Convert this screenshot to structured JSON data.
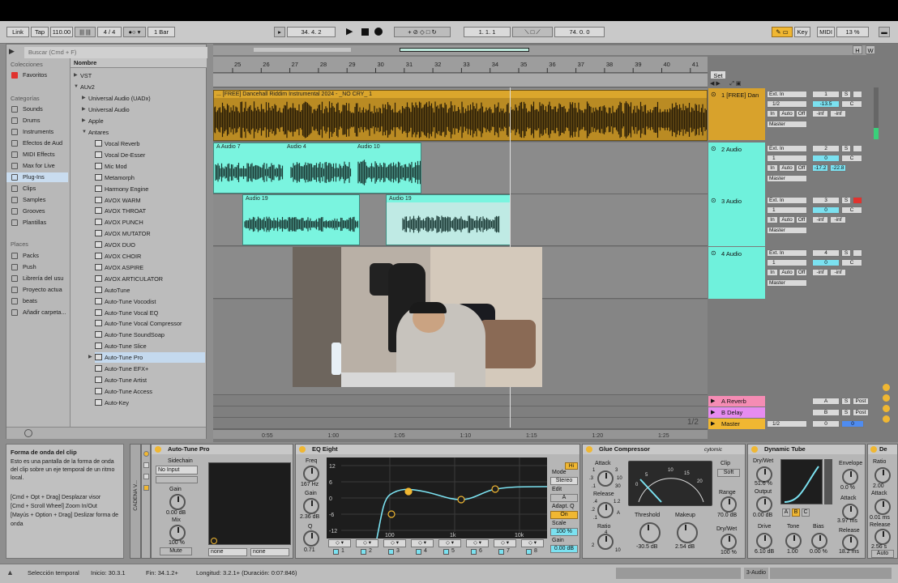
{
  "control_bar": {
    "link": "Link",
    "tap": "Tap",
    "tempo": "110.00",
    "signature": "4 / 4",
    "metro": "1 Bar",
    "position": "34.  4.  2",
    "loop_start": "1.  1.  1",
    "loop_length": "74.  0.  0",
    "key": "Key",
    "midi": "MIDI",
    "cpu": "13 %"
  },
  "browser": {
    "search_placeholder": "Buscar (Cmd + F)",
    "collections_title": "Colecciones",
    "favorites": "Favoritos",
    "categories_title": "Categorías",
    "categories": [
      "Sounds",
      "Drums",
      "Instruments",
      "Efectos de Aud",
      "MIDI Effects",
      "Max for Live",
      "Plug-Ins",
      "Clips",
      "Samples",
      "Grooves",
      "Plantillas"
    ],
    "places_title": "Places",
    "places": [
      "Packs",
      "Push",
      "Librería del usu",
      "Proyecto actua",
      "beats",
      "Añadir carpeta..."
    ],
    "name_header": "Nombre",
    "tree": [
      {
        "label": "VST",
        "indent": 0,
        "tri": "▶"
      },
      {
        "label": "AUv2",
        "indent": 0,
        "tri": "▼"
      },
      {
        "label": "Universal Audio (UADx)",
        "indent": 1,
        "tri": "▶"
      },
      {
        "label": "Universal Audio",
        "indent": 1,
        "tri": "▶"
      },
      {
        "label": "Apple",
        "indent": 1,
        "tri": "▶"
      },
      {
        "label": "Antares",
        "indent": 1,
        "tri": "▼"
      }
    ],
    "plugins": [
      "Vocal Reverb",
      "Vocal De-Esser",
      "Mic Mod",
      "Metamorph",
      "Harmony Engine",
      "AVOX WARM",
      "AVOX THROAT",
      "AVOX PUNCH",
      "AVOX MUTATOR",
      "AVOX DUO",
      "AVOX CHOIR",
      "AVOX ASPIRE",
      "AVOX ARTICULATOR",
      "AutoTune",
      "Auto-Tune Vocodist",
      "Auto-Tune Vocal EQ",
      "Auto-Tune Vocal Compressor",
      "Auto-Tune SoundSoap",
      "Auto-Tune Slice",
      "Auto-Tune Pro",
      "Auto-Tune EFX+",
      "Auto-Tune Artist",
      "Auto-Tune Access",
      "Auto-Key"
    ]
  },
  "ruler": {
    "bars": [
      "25",
      "26",
      "27",
      "28",
      "29",
      "30",
      "31",
      "32",
      "33",
      "34",
      "35",
      "36",
      "37",
      "38",
      "39",
      "40",
      "41"
    ],
    "time": [
      "0:55",
      "1:00",
      "1:05",
      "1:10",
      "1:15",
      "1:20",
      "1:25"
    ],
    "zoom": "1/2",
    "set": "Set"
  },
  "clips": {
    "beat": "... [FREE] Dancehall Riddim Instrumental 2024 - _NO CRY_ 1",
    "a7": "A Audio 7",
    "a4": "Audio 4",
    "a10": "Audio 10",
    "a19a": "Audio 19",
    "a19b": "Audio 19"
  },
  "tracks": [
    {
      "name": "1 [FREE] Dan",
      "num": "1",
      "color": "#d8a22c",
      "input": "Ext. In",
      "ch": "1/2",
      "vol": "-13.5",
      "pan": "C",
      "out": "Master",
      "peak1": "-inf",
      "peak2": "-inf"
    },
    {
      "name": "2 Audio",
      "num": "2",
      "color": "#6ff1dc",
      "input": "Ext. In",
      "ch": "1",
      "vol": "0",
      "pan": "C",
      "out": "Master",
      "peak1": "-17.2",
      "peak2": "-22.8"
    },
    {
      "name": "3 Audio",
      "num": "3",
      "color": "#6ff1dc",
      "input": "Ext. In",
      "ch": "1",
      "vol": "0",
      "pan": "C",
      "out": "Master",
      "peak1": "-inf",
      "peak2": "-inf"
    },
    {
      "name": "4 Audio",
      "num": "4",
      "color": "#6ff1dc",
      "input": "Ext. In",
      "ch": "1",
      "vol": "0",
      "pan": "C",
      "out": "Master",
      "peak1": "-inf",
      "peak2": "-inf"
    }
  ],
  "monitor": {
    "in": "In",
    "auto": "Auto",
    "off": "Off",
    "s": "S",
    "c": "C"
  },
  "returns": [
    {
      "name": "A Reverb",
      "letter": "A",
      "post": "Post",
      "color": "#f58cb4"
    },
    {
      "name": "B Delay",
      "letter": "B",
      "post": "Post",
      "color": "#e68cf0"
    },
    {
      "name": "Master",
      "letter": "0",
      "post": "",
      "color": "#f0b732",
      "ch": "1/2",
      "vol2": "0"
    }
  ],
  "info": {
    "title": "Forma de onda del clip",
    "text": "Esto es una pantalla de la forma de onda del clip sobre un eje temporal de un ritmo local.",
    "shortcuts": "[Cmd + Opt + Drag] Desplazar visor\n[Cmd + Scroll Wheel] Zoom In/Out\n[Mayús + Option + Drag] Deslizar forma de onda"
  },
  "devices": {
    "chain": "CADENA V...",
    "autotune": {
      "title": "Auto-Tune Pro",
      "sidechain": "Sidechain",
      "input": "No Input",
      "gain_label": "Gain",
      "gain": "0.00 dB",
      "mix_label": "Mix",
      "mix": "100 %",
      "mute": "Mute",
      "none1": "none",
      "none2": "none"
    },
    "eq": {
      "title": "EQ Eight",
      "freq_label": "Freq",
      "freq": "167 Hz",
      "gain_label": "Gain",
      "gain": "2.36 dB",
      "q_label": "Q",
      "q": "0.71",
      "mode_label": "Mode",
      "mode": "Stereo",
      "edit_label": "Edit",
      "edit": "A",
      "adapt_label": "Adapt. Q",
      "adapt": "On",
      "scale_label": "Scale",
      "scale": "100 %",
      "gain2_label": "Gain",
      "gain2": "0.00 dB",
      "y_ticks": [
        "12",
        "6",
        "0",
        "-6",
        "-12"
      ],
      "x_ticks": [
        "100",
        "1k",
        "10k"
      ],
      "bands": [
        "1",
        "2",
        "3",
        "4",
        "5",
        "6",
        "7",
        "8"
      ],
      "hi": "Hi"
    },
    "glue": {
      "title": "Glue Compressor",
      "brand": "cytomic",
      "attack_label": "Attack",
      "release_label": "Release",
      "ratio_label": "Ratio",
      "clip_label": "Clip",
      "clip": "Soft",
      "range_label": "Range",
      "range": "70.0 dB",
      "threshold_label": "Threshold",
      "threshold": "-30.5 dB",
      "makeup_label": "Makeup",
      "makeup": "2.54 dB",
      "drywet_label": "Dry/Wet",
      "drywet": "100 %",
      "attack_ticks": [
        "1",
        ".3",
        ".1",
        "3",
        "10",
        "30"
      ],
      "release_ticks": [
        ".4",
        ".2",
        ".1",
        "1.2",
        "A"
      ],
      "ratio_ticks": [
        "2",
        "4",
        "10"
      ],
      "meter_ticks": [
        "5",
        "10",
        "15",
        "20",
        "0"
      ]
    },
    "tube": {
      "title": "Dynamic Tube",
      "drywet_label": "Dry/Wet",
      "drywet": "51.6 %",
      "output_label": "Output",
      "output": "0.00 dB",
      "drive_label": "Drive",
      "drive": "6.10 dB",
      "tone_label": "Tone",
      "tone": "1.00",
      "bias_label": "Bias",
      "bias": "0.00 %",
      "envelope_label": "Envelope",
      "envelope": "0.0 %",
      "attack_label": "Attack",
      "attack": "3.97 ms",
      "release_label": "Release",
      "release": "18.2 ms",
      "abc": [
        "A",
        "B",
        "C"
      ]
    },
    "extra": {
      "ratio_label": "Ratio",
      "ratio": "2.00",
      "attack_label": "Attack",
      "attack": "0.01 ms",
      "release_label": "Release",
      "release": "2.56 s",
      "auto": "Auto"
    }
  },
  "status": {
    "text": "Selección temporal",
    "start": "Inicio: 30.3.1",
    "end": "Fin: 34.1.2+",
    "length": "Longitud: 3.2.1+ (Duración: 0:07:846)",
    "track": "3-Audio"
  }
}
